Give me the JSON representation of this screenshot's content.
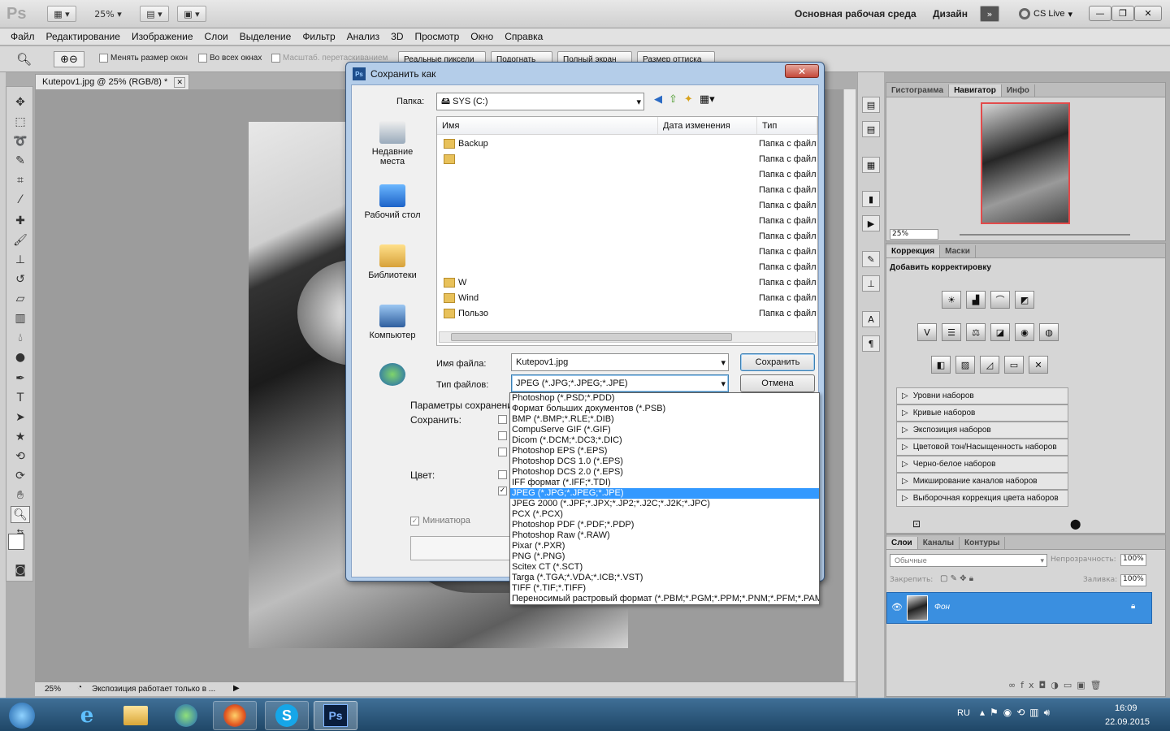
{
  "appbar": {
    "logo": "Ps",
    "zoom": "25%",
    "workspace_main": "Основная рабочая среда",
    "workspace_design": "Дизайн",
    "cs_live": "CS Live"
  },
  "menubar": [
    "Файл",
    "Редактирование",
    "Изображение",
    "Слои",
    "Выделение",
    "Фильтр",
    "Анализ",
    "3D",
    "Просмотр",
    "Окно",
    "Справка"
  ],
  "options": {
    "resize_windows": "Менять размер окон",
    "all_windows": "Во всех окнах",
    "scrubby": "Масштаб. перетаскиванием",
    "actual_pixels": "Реальные пиксели",
    "fit_screen": "Подогнать",
    "full_screen": "Полный экран",
    "print_size": "Размер оттиска"
  },
  "document": {
    "tab_title": "Kutepov1.jpg @ 25% (RGB/8) *",
    "status_zoom": "25%",
    "status_text": "Экспозиция работает только в ..."
  },
  "dialog": {
    "title": "Сохранить как",
    "folder_label": "Папка:",
    "folder_value": "SYS (C:)",
    "places": [
      "Недавние места",
      "Рабочий стол",
      "Библиотеки",
      "Компьютер"
    ],
    "columns": [
      "Имя",
      "Дата изменения",
      "Тип"
    ],
    "files": [
      {
        "name": "Backup",
        "type": "Папка с файл"
      },
      {
        "name": "",
        "type": "Папка с файл"
      },
      {
        "name": "",
        "type": "Папка с файл"
      },
      {
        "name": "",
        "type": "Папка с файл"
      },
      {
        "name": "",
        "type": "Папка с файл"
      },
      {
        "name": "",
        "type": "Папка с файл"
      },
      {
        "name": "",
        "type": "Папка с файл"
      },
      {
        "name": "",
        "type": "Папка с файл"
      },
      {
        "name": "",
        "type": "Папка с файл"
      },
      {
        "name": "W",
        "type": "Папка с файл"
      },
      {
        "name": "Wind",
        "type": "Папка с файл"
      },
      {
        "name": "Пользо",
        "type": "Папка с файл"
      }
    ],
    "filename_label": "Имя файла:",
    "filename_value": "Kutepov1.jpg",
    "filetype_label": "Тип файлов:",
    "filetype_value": "JPEG (*.JPG;*.JPEG;*.JPE)",
    "save_button": "Сохранить",
    "cancel_button": "Отмена",
    "save_options_label": "Параметры сохранения",
    "save_label": "Сохранить:",
    "color_label": "Цвет:",
    "thumbnail_label": "Миниатюра"
  },
  "filetypes": [
    "Photoshop (*.PSD;*.PDD)",
    "Формат больших документов (*.PSB)",
    "BMP (*.BMP;*.RLE;*.DIB)",
    "CompuServe GIF (*.GIF)",
    "Dicom (*.DCM;*.DC3;*.DIC)",
    "Photoshop EPS (*.EPS)",
    "Photoshop DCS 1.0 (*.EPS)",
    "Photoshop DCS 2.0 (*.EPS)",
    "IFF формат (*.IFF;*.TDI)",
    "JPEG (*.JPG;*.JPEG;*.JPE)",
    "JPEG 2000 (*.JPF;*.JPX;*.JP2;*.J2C;*.J2K;*.JPC)",
    "PCX (*.PCX)",
    "Photoshop PDF (*.PDF;*.PDP)",
    "Photoshop Raw (*.RAW)",
    "Pixar (*.PXR)",
    "PNG (*.PNG)",
    "Scitex CT (*.SCT)",
    "Targa (*.TGA;*.VDA;*.ICB;*.VST)",
    "TIFF (*.TIF;*.TIFF)",
    "Переносимый растровый формат (*.PBM;*.PGM;*.PPM;*.PNM;*.PFM;*.PAM)"
  ],
  "selected_filetype_index": 9,
  "navigator": {
    "tabs": [
      "Гистограмма",
      "Навигатор",
      "Инфо"
    ],
    "zoom": "25%"
  },
  "adjustments": {
    "tabs": [
      "Коррекция",
      "Маски"
    ],
    "heading": "Добавить корректировку",
    "presets": [
      "Уровни наборов",
      "Кривые наборов",
      "Экспозиция наборов",
      "Цветовой тон/Насыщенность наборов",
      "Черно-белое наборов",
      "Микширование каналов наборов",
      "Выборочная коррекция цвета наборов"
    ]
  },
  "layers": {
    "tabs": [
      "Слои",
      "Каналы",
      "Контуры"
    ],
    "blend_mode": "Обычные",
    "opacity_label": "Непрозрачность:",
    "opacity_value": "100%",
    "lock_label": "Закрепить:",
    "fill_label": "Заливка:",
    "fill_value": "100%",
    "layer_name": "Фон"
  },
  "taskbar": {
    "lang": "RU",
    "time": "16:09",
    "date": "22.09.2015",
    "ps_label": "Ps"
  },
  "colors": {
    "selection_blue": "#3399ff",
    "layer_selected": "#3a8fe0",
    "taskbar": "#2a5a80"
  }
}
